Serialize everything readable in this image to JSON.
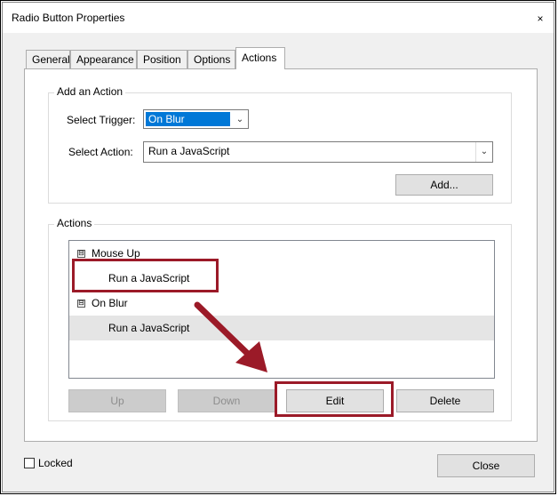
{
  "window": {
    "title": "Radio Button Properties",
    "close_glyph": "×"
  },
  "tabs": [
    {
      "label": "General"
    },
    {
      "label": "Appearance"
    },
    {
      "label": "Position"
    },
    {
      "label": "Options"
    },
    {
      "label": "Actions",
      "active": true
    }
  ],
  "add_action": {
    "group_label": "Add an Action",
    "trigger_label": "Select Trigger:",
    "trigger_value": "On Blur",
    "action_label": "Select Action:",
    "action_value": "Run a JavaScript",
    "add_button": "Add..."
  },
  "actions": {
    "group_label": "Actions",
    "tree": [
      {
        "trigger": "Mouse Up",
        "expander": "⊟",
        "children": [
          "Run a JavaScript"
        ]
      },
      {
        "trigger": "On Blur",
        "expander": "⊟",
        "children": [
          "Run a JavaScript"
        ]
      }
    ],
    "buttons": {
      "up": "Up",
      "down": "Down",
      "edit": "Edit",
      "delete": "Delete"
    }
  },
  "footer": {
    "locked_label": "Locked",
    "locked_checked": false,
    "close_button": "Close"
  },
  "colors": {
    "highlight": "#0078d7",
    "annotation_red": "#9b1a28",
    "selected_row": "#e5e5e5"
  }
}
